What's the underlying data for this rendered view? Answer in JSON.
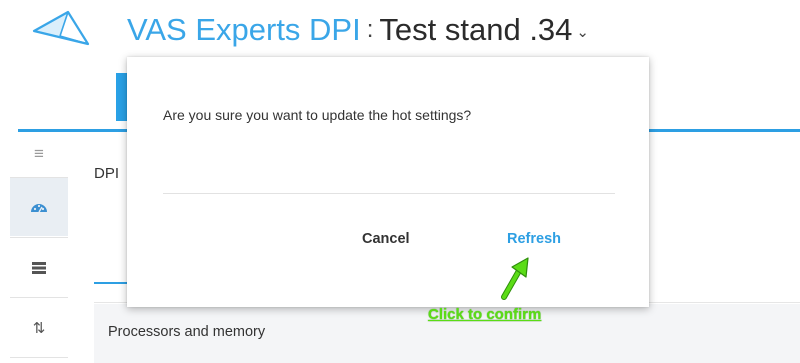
{
  "header": {
    "brand": "VAS Experts DPI",
    "separator": ":",
    "stand": "Test stand .34",
    "chevron": "⌄",
    "logo_icon": "paper-plane-logo",
    "accent_color": "#2d9fe3"
  },
  "sidebar": {
    "items": [
      {
        "icon": "hamburger-menu-icon",
        "glyph": "≡"
      },
      {
        "icon": "dashboard-gauge-icon"
      },
      {
        "icon": "server-list-icon"
      },
      {
        "icon": "sort-icon",
        "glyph": "⇅"
      }
    ]
  },
  "main": {
    "dpi_label": "DPI",
    "section_label": "Processors and memory"
  },
  "modal": {
    "message": "Are you sure you want to update the hot settings?",
    "cancel_label": "Cancel",
    "refresh_label": "Refresh"
  },
  "annotation": {
    "text": "Click to confirm",
    "color": "#5bdc16",
    "arrow_icon": "green-arrow-icon"
  }
}
